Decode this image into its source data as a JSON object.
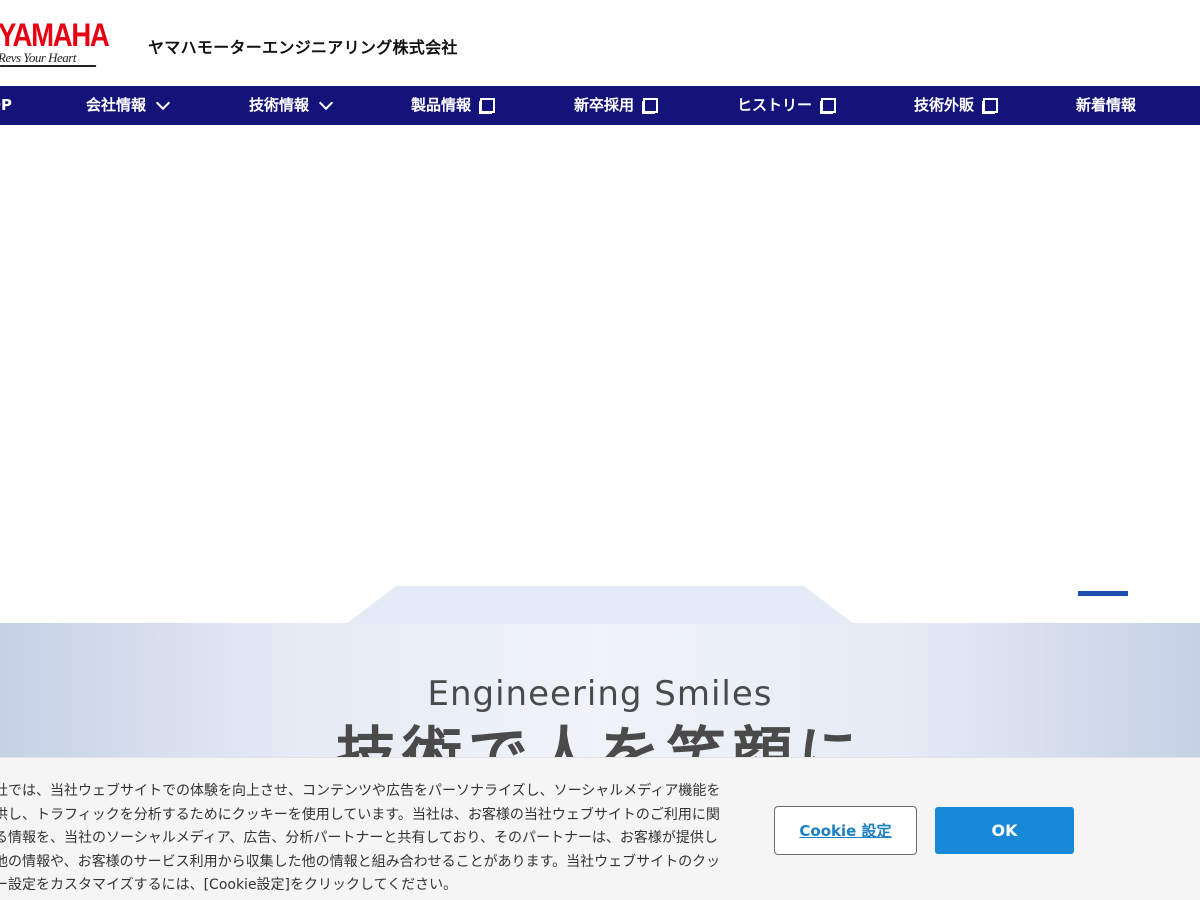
{
  "header": {
    "logo_word": "YAMAHA",
    "logo_tagline": "Revs Your Heart",
    "company_name": "ヤマハモーターエンジニアリング株式会社"
  },
  "nav": {
    "items": [
      {
        "label": "TOP",
        "icon": ""
      },
      {
        "label": "会社情報",
        "icon": "chevron-down-icon"
      },
      {
        "label": "技術情報",
        "icon": "chevron-down-icon"
      },
      {
        "label": "製品情報",
        "icon": "external-window-icon"
      },
      {
        "label": "新卒採用",
        "icon": "external-window-icon"
      },
      {
        "label": "ヒストリー",
        "icon": "external-window-icon"
      },
      {
        "label": "技術外販",
        "icon": "external-window-icon"
      },
      {
        "label": "新着情報",
        "icon": ""
      }
    ]
  },
  "hero": {
    "tagline_en": "Engineering Smiles",
    "tagline_ja": "技術で人を笑顔に"
  },
  "cookie": {
    "lines": [
      "当社では、当社ウェブサイトでの体験を向上させ、コンテンツや広告をパーソナライズし、ソーシャルメディア機能を",
      "提供し、トラフィックを分析するためにクッキーを使用しています。当社は、お客様の当社ウェブサイトのご利用に関",
      "する情報を、当社のソーシャルメディア、広告、分析パートナーと共有しており、そのパートナーは、お客様が提供し",
      "た他の情報や、お客様のサービス利用から収集した他の情報と組み合わせることがあります。当社ウェブサイトのクッ",
      "キー設定をカスタマイズするには、[Cookie設定]をクリックしてください。"
    ],
    "settings_label": "Cookie 設定",
    "ok_label": "OK"
  },
  "colors": {
    "nav_bg": "#14137a",
    "brand_red": "#e60012",
    "ok_button": "#1789d6",
    "settings_link": "#1a7fc4",
    "indicator": "#1e4fae"
  }
}
